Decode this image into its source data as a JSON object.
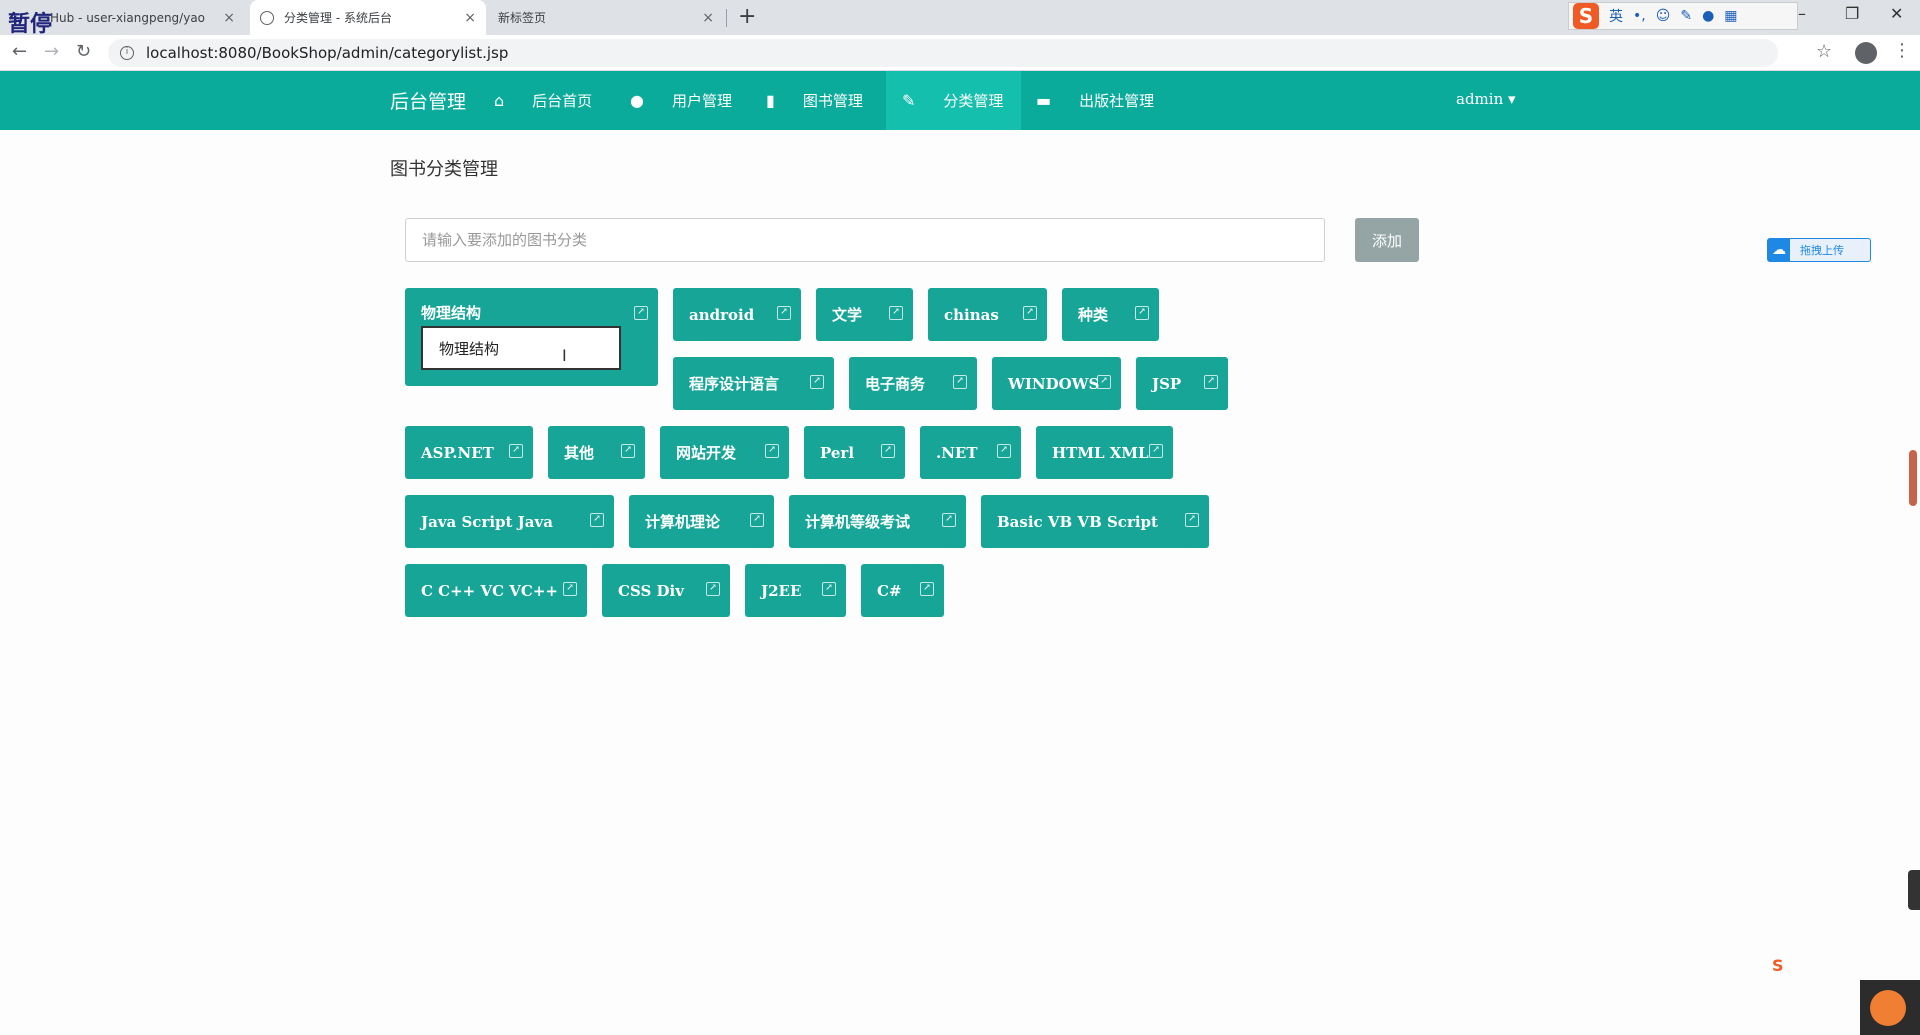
{
  "browser": {
    "overlay_text": "暂停",
    "tabs": [
      {
        "title": "Hub - user-xiangpeng/yao",
        "close": "×"
      },
      {
        "title": "分类管理 - 系统后台",
        "close": "×"
      },
      {
        "title": "新标签页",
        "close": "×"
      }
    ],
    "new_tab": "+",
    "url": "localhost:8080/BookShop/admin/categorylist.jsp",
    "ime": {
      "logo": "S",
      "lang": "英",
      "punct": "•,"
    },
    "window_controls": {
      "minimize": "–",
      "restore": "❐",
      "close": "✕"
    }
  },
  "navbar": {
    "brand": "后台管理",
    "items": [
      {
        "icon": "home-icon",
        "label": "后台首页",
        "active": false
      },
      {
        "icon": "user-icon",
        "label": "用户管理",
        "active": false
      },
      {
        "icon": "book-icon",
        "label": "图书管理",
        "active": false
      },
      {
        "icon": "pin-icon",
        "label": "分类管理",
        "active": true
      },
      {
        "icon": "briefcase-icon",
        "label": "出版社管理",
        "active": false
      }
    ],
    "user_menu": "admin ▾"
  },
  "page": {
    "title": "图书分类管理",
    "add_input_placeholder": "请输入要添加的图书分类",
    "add_button": "添加",
    "upload_widget": "拖拽上传"
  },
  "categories": [
    {
      "name": "物理结构",
      "editing": true,
      "edit_value": "物理结构"
    },
    {
      "name": "android"
    },
    {
      "name": "文学"
    },
    {
      "name": "chinas"
    },
    {
      "name": "种类"
    },
    {
      "name": "程序设计语言"
    },
    {
      "name": "电子商务"
    },
    {
      "name": "WINDOWS"
    },
    {
      "name": "JSP"
    },
    {
      "name": "ASP.NET"
    },
    {
      "name": "其他"
    },
    {
      "name": "网站开发"
    },
    {
      "name": "Perl"
    },
    {
      "name": ".NET"
    },
    {
      "name": "HTML XML"
    },
    {
      "name": "Java Script Java"
    },
    {
      "name": "计算机理论"
    },
    {
      "name": "计算机等级考试"
    },
    {
      "name": "Basic VB VB Script"
    },
    {
      "name": "C C++ VC VC++"
    },
    {
      "name": "CSS Div"
    },
    {
      "name": "J2EE"
    },
    {
      "name": "C#"
    }
  ],
  "colors": {
    "navbar": "#0aab9b",
    "nav_active": "#15bfae",
    "tag": "#17a597",
    "add_button": "#95a5a6"
  }
}
